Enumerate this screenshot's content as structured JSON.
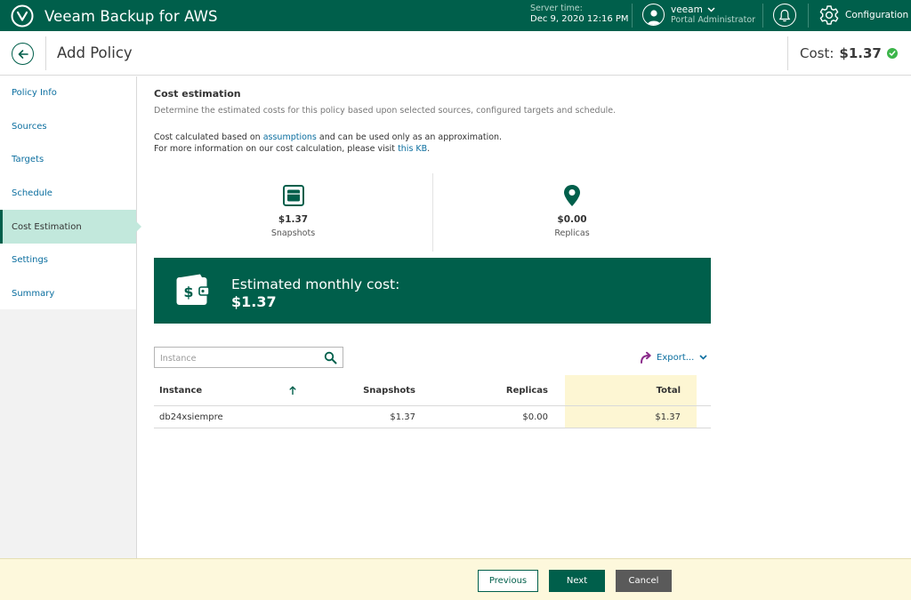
{
  "app": {
    "title": "Veeam Backup for AWS",
    "server_time_label": "Server time:",
    "server_time": "Dec 9, 2020 12:16 PM",
    "user_name": "veeam",
    "user_role": "Portal Administrator",
    "config_label": "Configuration"
  },
  "header": {
    "title": "Add Policy",
    "cost_label": "Cost:",
    "cost_value": "$1.37"
  },
  "sidebar": {
    "items": [
      {
        "label": "Policy Info"
      },
      {
        "label": "Sources"
      },
      {
        "label": "Targets"
      },
      {
        "label": "Schedule"
      },
      {
        "label": "Cost Estimation",
        "active": true
      },
      {
        "label": "Settings"
      },
      {
        "label": "Summary"
      }
    ]
  },
  "main": {
    "section_title": "Cost estimation",
    "section_desc": "Determine the estimated costs for this policy based upon selected sources, configured targets and schedule.",
    "info_line1_pre": "Cost calculated based on ",
    "info_line1_link": "assumptions",
    "info_line1_post": " and can be used only as an approximation.",
    "info_line2_pre": "For more information on our cost calculation, please visit ",
    "info_line2_link": "this KB",
    "info_line2_post": ".",
    "stats": {
      "snapshots_value": "$1.37",
      "snapshots_label": "Snapshots",
      "replicas_value": "$0.00",
      "replicas_label": "Replicas"
    },
    "banner": {
      "label": "Estimated monthly cost:",
      "value": "$1.37"
    },
    "search_placeholder": "Instance",
    "export_label": "Export...",
    "table": {
      "columns": [
        "Instance",
        "Snapshots",
        "Replicas",
        "Total"
      ],
      "rows": [
        [
          "db24xsiempre",
          "$1.37",
          "$0.00",
          "$1.37"
        ]
      ]
    }
  },
  "footer": {
    "previous": "Previous",
    "next": "Next",
    "cancel": "Cancel"
  },
  "colors": {
    "brand": "#005f4b",
    "active_nav": "#c2e8dc",
    "link": "#0b6e9f",
    "footer_bg": "#fdf8dc",
    "total_col_bg": "#fdf6d3"
  }
}
